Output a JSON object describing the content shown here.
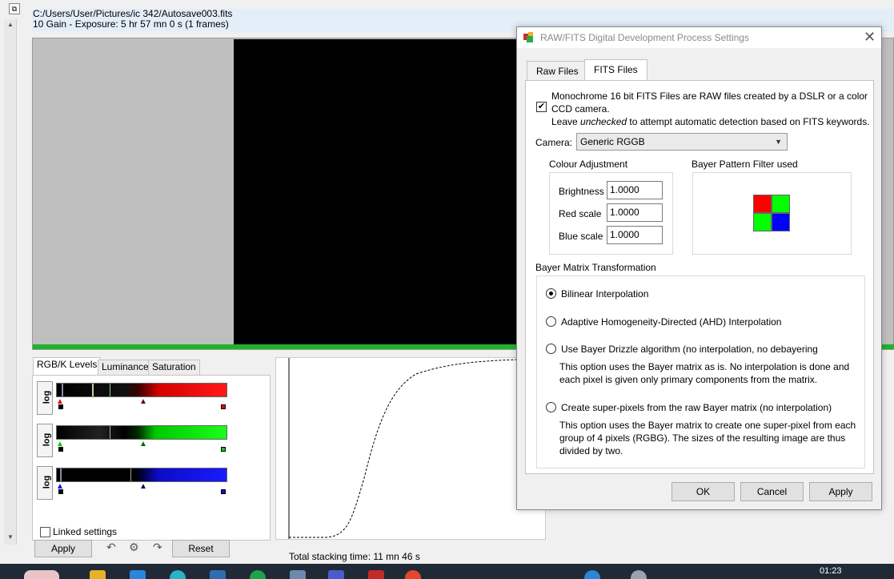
{
  "file": {
    "path": "C:/Users/User/Pictures/ic 342/Autosave003.fits",
    "info": "10 Gain - Exposure: 5 hr 57 mn 0 s (1 frames)"
  },
  "levels": {
    "tabs": [
      "RGB/K Levels",
      "Luminance",
      "Saturation"
    ],
    "log_label": "log",
    "linked_label": "Linked settings",
    "apply_label": "Apply",
    "reset_label": "Reset"
  },
  "status": {
    "total_time": "Total stacking time: 11 mn 46 s"
  },
  "taskbar": {
    "time": "01:23"
  },
  "dialog": {
    "title": "RAW/FITS Digital Development Process Settings",
    "tabs": [
      "Raw Files",
      "FITS Files"
    ],
    "mono_label_line1": "Monochrome 16 bit FITS Files are RAW files created by a DSLR or a color",
    "mono_label_line2": "CCD camera.",
    "leave_text_pre": "Leave ",
    "leave_text_em": "unchecked",
    "leave_text_post": " to attempt automatic detection based on FITS keywords.",
    "mono_checked": true,
    "camera_label": "Camera:",
    "camera_value": "Generic RGGB",
    "colour_adjustment_label": "Colour Adjustment",
    "brightness_label": "Brightness",
    "brightness_value": "1.0000",
    "red_label": "Red scale",
    "red_value": "1.0000",
    "blue_label": "Blue scale",
    "blue_value": "1.0000",
    "bayer_filter_label": "Bayer Pattern Filter used",
    "bayer_colors": [
      "#ff0000",
      "#00ff00",
      "#00ff00",
      "#0000ff"
    ],
    "bayer_matrix_label": "Bayer Matrix Transformation",
    "options": {
      "bilinear": "Bilinear Interpolation",
      "ahd": "Adaptive Homogeneity-Directed (AHD) Interpolation",
      "drizzle": "Use Bayer Drizzle algorithm (no interpolation, no debayering",
      "drizzle_desc1": "This option uses the Bayer matrix as is. No interpolation is done and",
      "drizzle_desc2": "each pixel is given only primary components from the matrix.",
      "superpixel": "Create super-pixels from the raw Bayer matrix (no interpolation)",
      "superpixel_desc1": "This option uses the Bayer matrix to create one super-pixel from each",
      "superpixel_desc2": "group of 4 pixels (RGBG). The sizes of the resulting image are thus",
      "superpixel_desc3": "divided by two."
    },
    "selected_option": "bilinear",
    "ok_label": "OK",
    "cancel_label": "Cancel",
    "apply_label": "Apply"
  },
  "colors": {
    "progress": "#1fb32c",
    "red_channel": "#d40000",
    "green_channel": "#00d000",
    "blue_channel": "#1010d0"
  }
}
